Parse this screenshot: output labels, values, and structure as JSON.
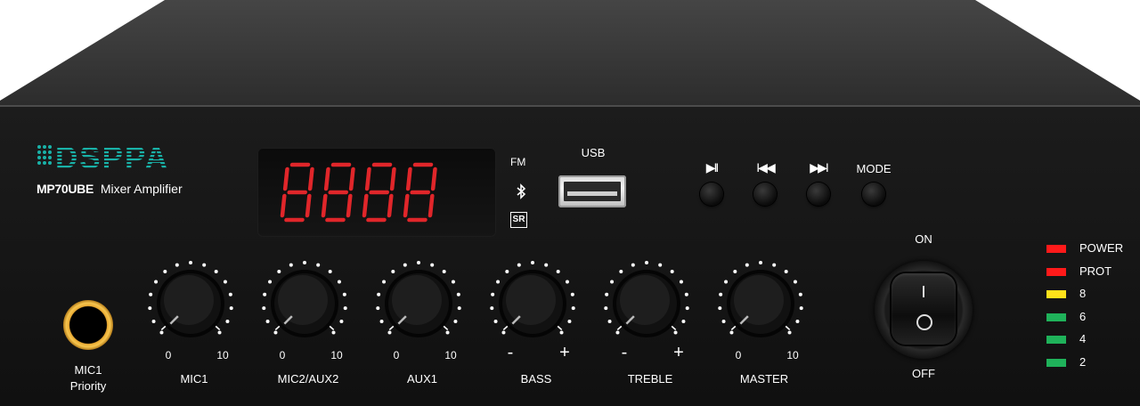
{
  "brand": {
    "logo_text": "DSPPA",
    "model": "MP70UBE",
    "description": "Mixer Amplifier"
  },
  "display": {
    "digits": "8888",
    "digit_color": "#e0262a"
  },
  "source_icons": {
    "fm": "FM",
    "bluetooth": "bluetooth-icon",
    "sr": "SR"
  },
  "usb": {
    "label": "USB"
  },
  "transport": [
    {
      "id": "play-pause",
      "icon": "▶II",
      "name": "play-pause-icon"
    },
    {
      "id": "previous",
      "icon": "I◀◀",
      "name": "previous-icon"
    },
    {
      "id": "next",
      "icon": "▶▶I",
      "name": "next-icon"
    },
    {
      "id": "mode",
      "icon": "MODE",
      "name": "mode-label"
    }
  ],
  "mic1_input": {
    "label_line1": "MIC1",
    "label_line2": "Priority"
  },
  "knobs": [
    {
      "label": "MIC1",
      "min": "0",
      "max": "10"
    },
    {
      "label": "MIC2/AUX2",
      "min": "0",
      "max": "10"
    },
    {
      "label": "AUX1",
      "min": "0",
      "max": "10"
    },
    {
      "label": "BASS",
      "min": "-",
      "max": "+"
    },
    {
      "label": "TREBLE",
      "min": "-",
      "max": "+"
    },
    {
      "label": "MASTER",
      "min": "0",
      "max": "10"
    }
  ],
  "power_switch": {
    "on_label": "ON",
    "off_label": "OFF"
  },
  "indicators": [
    {
      "label": "POWER",
      "color": "#ff1a1a"
    },
    {
      "label": "PROT",
      "color": "#ff1a1a"
    },
    {
      "label": "8",
      "color": "#ffe11a"
    },
    {
      "label": "6",
      "color": "#1fb25a"
    },
    {
      "label": "4",
      "color": "#1fb25a"
    },
    {
      "label": "2",
      "color": "#1fb25a"
    }
  ],
  "colors": {
    "panel": "#141414",
    "top": "#3a3a3a",
    "text": "#ffffff",
    "logo": "#19b2a8"
  }
}
